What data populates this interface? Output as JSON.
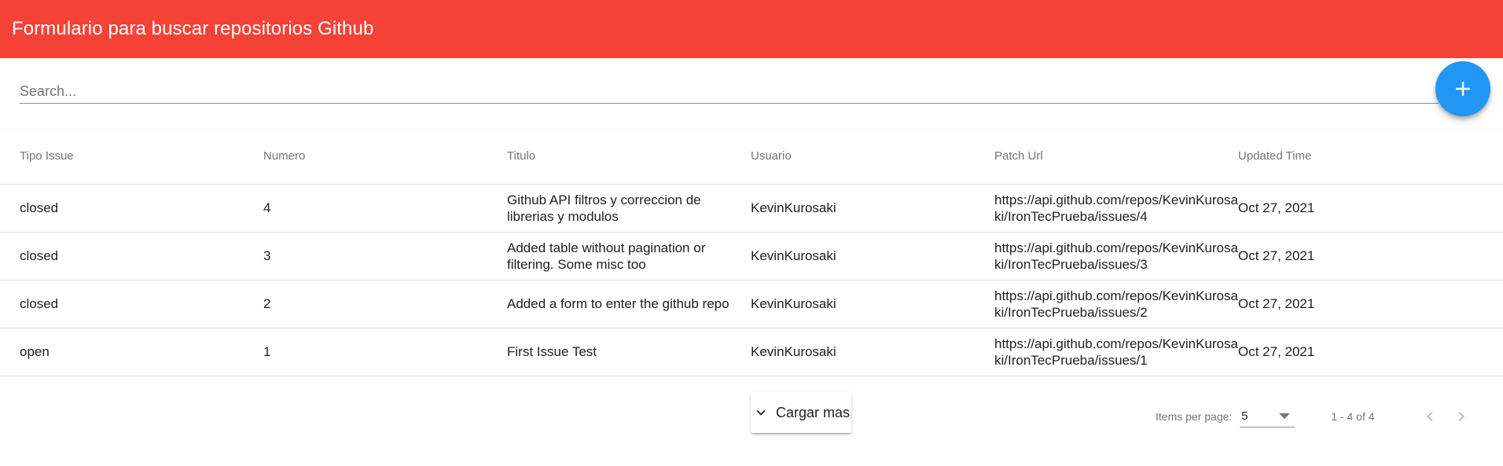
{
  "toolbar": {
    "title": "Formulario para buscar repositorios Github",
    "color": "#f44336"
  },
  "search": {
    "placeholder": "Search...",
    "value": ""
  },
  "fab": {
    "icon": "plus-icon",
    "color": "#2196f3"
  },
  "table": {
    "columns": [
      "Tipo Issue",
      "Numero",
      "Titulo",
      "Usuario",
      "Patch Url",
      "Updated Time"
    ],
    "rows": [
      {
        "tipo": "closed",
        "numero": "4",
        "titulo": "Github API filtros y correccion de librerias y modulos",
        "usuario": "KevinKurosaki",
        "url": "https://api.github.com/repos/KevinKurosaki/IronTecPrueba/issues/4",
        "updated": "Oct 27, 2021"
      },
      {
        "tipo": "closed",
        "numero": "3",
        "titulo": "Added table without pagination or filtering. Some misc too",
        "usuario": "KevinKurosaki",
        "url": "https://api.github.com/repos/KevinKurosaki/IronTecPrueba/issues/3",
        "updated": "Oct 27, 2021"
      },
      {
        "tipo": "closed",
        "numero": "2",
        "titulo": "Added a form to enter the github repo",
        "usuario": "KevinKurosaki",
        "url": "https://api.github.com/repos/KevinKurosaki/IronTecPrueba/issues/2",
        "updated": "Oct 27, 2021"
      },
      {
        "tipo": "open",
        "numero": "1",
        "titulo": "First Issue Test",
        "usuario": "KevinKurosaki",
        "url": "https://api.github.com/repos/KevinKurosaki/IronTecPrueba/issues/1",
        "updated": "Oct 27, 2021"
      }
    ]
  },
  "load_more": {
    "label": "Cargar mas",
    "icon": "chevron-down-icon"
  },
  "paginator": {
    "items_per_page_label": "Items per page:",
    "page_size": "5",
    "range_label": "1 - 4 of 4",
    "prev_icon": "chevron-left-icon",
    "next_icon": "chevron-right-icon"
  }
}
